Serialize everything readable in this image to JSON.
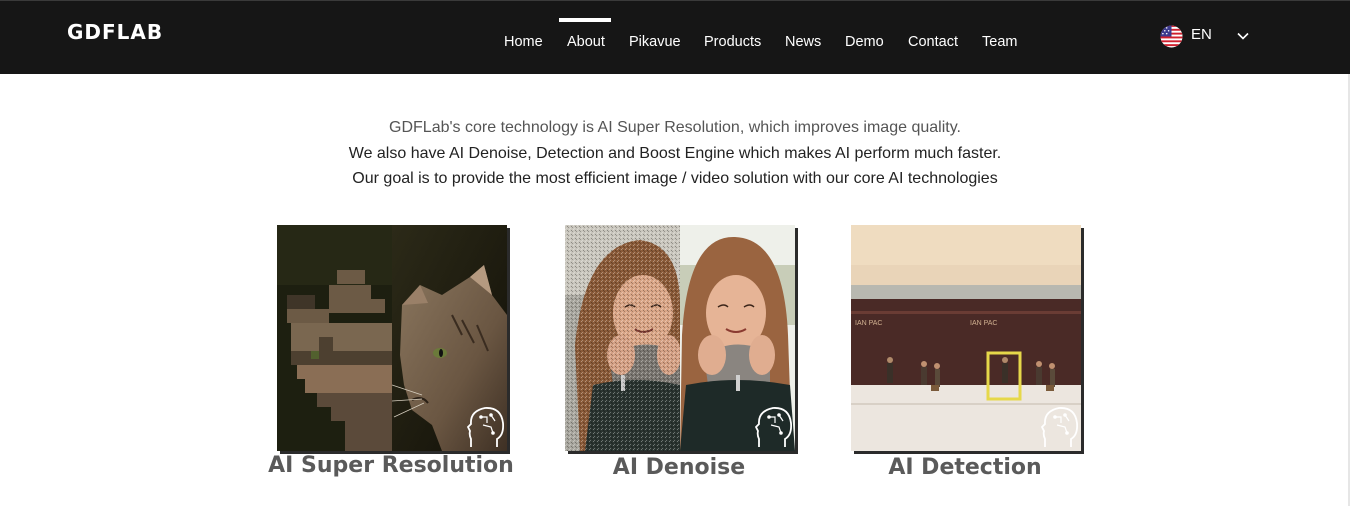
{
  "nav": {
    "logo": "GDFLAB",
    "items": [
      {
        "label": "Home"
      },
      {
        "label": "About",
        "active": true
      },
      {
        "label": "Pikavue"
      },
      {
        "label": "Products"
      },
      {
        "label": "News"
      },
      {
        "label": "Demo"
      },
      {
        "label": "Contact"
      },
      {
        "label": "Team"
      }
    ],
    "language": {
      "label": "EN",
      "flag_icon": "us-flag-icon",
      "dropdown_icon": "chevron-down-icon"
    }
  },
  "intro": {
    "line1": "GDFLab's core technology is AI Super Resolution, which improves image quality.",
    "line2": "We also have AI Denoise, Detection and Boost Engine which makes AI perform much faster.",
    "line3": "Our goal is to provide the most efficient image / video solution with our core AI technologies"
  },
  "cards": [
    {
      "title": "AI Super Resolution",
      "image": "cat-comparison",
      "icon": "ai-head-icon"
    },
    {
      "title": "AI Denoise",
      "image": "girl-comparison",
      "icon": "ai-head-icon"
    },
    {
      "title": "AI Detection",
      "image": "train-figures-comparison",
      "icon": "ai-head-icon"
    }
  ],
  "colors": {
    "nav_bg": "#161616",
    "title_gray": "#5a5a5a",
    "detection_box": "#e6d84a"
  }
}
